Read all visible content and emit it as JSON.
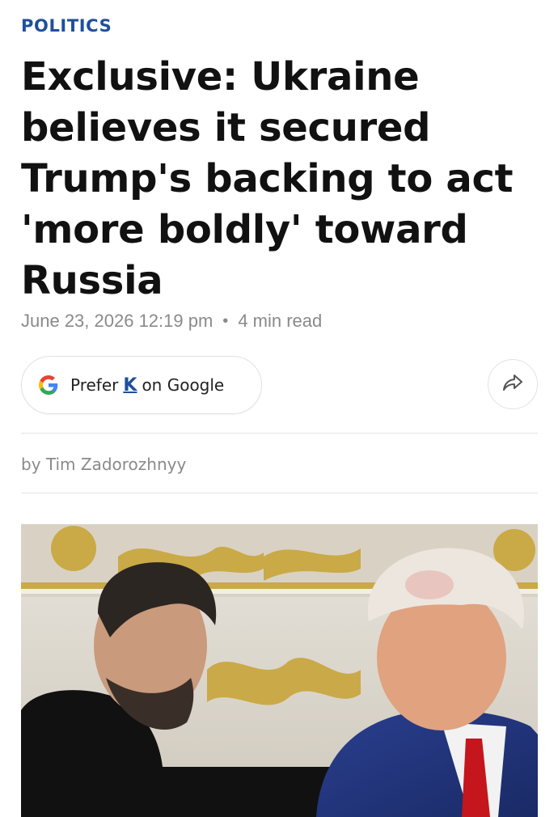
{
  "article": {
    "category": "POLITICS",
    "headline": "Exclusive: Ukraine believes it secured Trump's backing to act 'more boldly' toward Russia",
    "date": "June 23, 2026 12:19 pm",
    "separator": "•",
    "read_time": "4 min read",
    "byline": "by Tim Zadorozhnyy"
  },
  "google_pill": {
    "prefix": "Prefer",
    "brand": "K",
    "suffix": "on Google",
    "icon": "google-g-icon"
  },
  "share": {
    "icon": "share-arrow-icon"
  },
  "photo": {
    "alt_subject": "two-men-conversation-photo"
  },
  "colors": {
    "category": "#1f4f9c",
    "brand": "#1f4f9c",
    "meta": "#8a8a8a",
    "divider": "#e4e4e4"
  }
}
